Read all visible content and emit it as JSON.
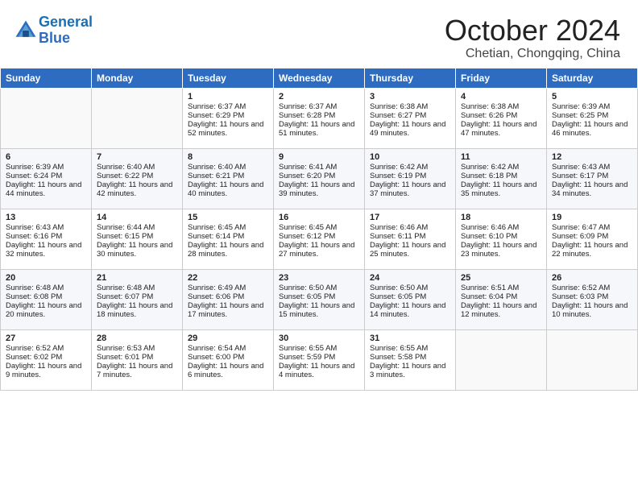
{
  "header": {
    "logo_line1": "General",
    "logo_line2": "Blue",
    "month": "October 2024",
    "location": "Chetian, Chongqing, China"
  },
  "days_of_week": [
    "Sunday",
    "Monday",
    "Tuesday",
    "Wednesday",
    "Thursday",
    "Friday",
    "Saturday"
  ],
  "weeks": [
    [
      {
        "day": "",
        "sunrise": "",
        "sunset": "",
        "daylight": ""
      },
      {
        "day": "",
        "sunrise": "",
        "sunset": "",
        "daylight": ""
      },
      {
        "day": "1",
        "sunrise": "Sunrise: 6:37 AM",
        "sunset": "Sunset: 6:29 PM",
        "daylight": "Daylight: 11 hours and 52 minutes."
      },
      {
        "day": "2",
        "sunrise": "Sunrise: 6:37 AM",
        "sunset": "Sunset: 6:28 PM",
        "daylight": "Daylight: 11 hours and 51 minutes."
      },
      {
        "day": "3",
        "sunrise": "Sunrise: 6:38 AM",
        "sunset": "Sunset: 6:27 PM",
        "daylight": "Daylight: 11 hours and 49 minutes."
      },
      {
        "day": "4",
        "sunrise": "Sunrise: 6:38 AM",
        "sunset": "Sunset: 6:26 PM",
        "daylight": "Daylight: 11 hours and 47 minutes."
      },
      {
        "day": "5",
        "sunrise": "Sunrise: 6:39 AM",
        "sunset": "Sunset: 6:25 PM",
        "daylight": "Daylight: 11 hours and 46 minutes."
      }
    ],
    [
      {
        "day": "6",
        "sunrise": "Sunrise: 6:39 AM",
        "sunset": "Sunset: 6:24 PM",
        "daylight": "Daylight: 11 hours and 44 minutes."
      },
      {
        "day": "7",
        "sunrise": "Sunrise: 6:40 AM",
        "sunset": "Sunset: 6:22 PM",
        "daylight": "Daylight: 11 hours and 42 minutes."
      },
      {
        "day": "8",
        "sunrise": "Sunrise: 6:40 AM",
        "sunset": "Sunset: 6:21 PM",
        "daylight": "Daylight: 11 hours and 40 minutes."
      },
      {
        "day": "9",
        "sunrise": "Sunrise: 6:41 AM",
        "sunset": "Sunset: 6:20 PM",
        "daylight": "Daylight: 11 hours and 39 minutes."
      },
      {
        "day": "10",
        "sunrise": "Sunrise: 6:42 AM",
        "sunset": "Sunset: 6:19 PM",
        "daylight": "Daylight: 11 hours and 37 minutes."
      },
      {
        "day": "11",
        "sunrise": "Sunrise: 6:42 AM",
        "sunset": "Sunset: 6:18 PM",
        "daylight": "Daylight: 11 hours and 35 minutes."
      },
      {
        "day": "12",
        "sunrise": "Sunrise: 6:43 AM",
        "sunset": "Sunset: 6:17 PM",
        "daylight": "Daylight: 11 hours and 34 minutes."
      }
    ],
    [
      {
        "day": "13",
        "sunrise": "Sunrise: 6:43 AM",
        "sunset": "Sunset: 6:16 PM",
        "daylight": "Daylight: 11 hours and 32 minutes."
      },
      {
        "day": "14",
        "sunrise": "Sunrise: 6:44 AM",
        "sunset": "Sunset: 6:15 PM",
        "daylight": "Daylight: 11 hours and 30 minutes."
      },
      {
        "day": "15",
        "sunrise": "Sunrise: 6:45 AM",
        "sunset": "Sunset: 6:14 PM",
        "daylight": "Daylight: 11 hours and 28 minutes."
      },
      {
        "day": "16",
        "sunrise": "Sunrise: 6:45 AM",
        "sunset": "Sunset: 6:12 PM",
        "daylight": "Daylight: 11 hours and 27 minutes."
      },
      {
        "day": "17",
        "sunrise": "Sunrise: 6:46 AM",
        "sunset": "Sunset: 6:11 PM",
        "daylight": "Daylight: 11 hours and 25 minutes."
      },
      {
        "day": "18",
        "sunrise": "Sunrise: 6:46 AM",
        "sunset": "Sunset: 6:10 PM",
        "daylight": "Daylight: 11 hours and 23 minutes."
      },
      {
        "day": "19",
        "sunrise": "Sunrise: 6:47 AM",
        "sunset": "Sunset: 6:09 PM",
        "daylight": "Daylight: 11 hours and 22 minutes."
      }
    ],
    [
      {
        "day": "20",
        "sunrise": "Sunrise: 6:48 AM",
        "sunset": "Sunset: 6:08 PM",
        "daylight": "Daylight: 11 hours and 20 minutes."
      },
      {
        "day": "21",
        "sunrise": "Sunrise: 6:48 AM",
        "sunset": "Sunset: 6:07 PM",
        "daylight": "Daylight: 11 hours and 18 minutes."
      },
      {
        "day": "22",
        "sunrise": "Sunrise: 6:49 AM",
        "sunset": "Sunset: 6:06 PM",
        "daylight": "Daylight: 11 hours and 17 minutes."
      },
      {
        "day": "23",
        "sunrise": "Sunrise: 6:50 AM",
        "sunset": "Sunset: 6:05 PM",
        "daylight": "Daylight: 11 hours and 15 minutes."
      },
      {
        "day": "24",
        "sunrise": "Sunrise: 6:50 AM",
        "sunset": "Sunset: 6:05 PM",
        "daylight": "Daylight: 11 hours and 14 minutes."
      },
      {
        "day": "25",
        "sunrise": "Sunrise: 6:51 AM",
        "sunset": "Sunset: 6:04 PM",
        "daylight": "Daylight: 11 hours and 12 minutes."
      },
      {
        "day": "26",
        "sunrise": "Sunrise: 6:52 AM",
        "sunset": "Sunset: 6:03 PM",
        "daylight": "Daylight: 11 hours and 10 minutes."
      }
    ],
    [
      {
        "day": "27",
        "sunrise": "Sunrise: 6:52 AM",
        "sunset": "Sunset: 6:02 PM",
        "daylight": "Daylight: 11 hours and 9 minutes."
      },
      {
        "day": "28",
        "sunrise": "Sunrise: 6:53 AM",
        "sunset": "Sunset: 6:01 PM",
        "daylight": "Daylight: 11 hours and 7 minutes."
      },
      {
        "day": "29",
        "sunrise": "Sunrise: 6:54 AM",
        "sunset": "Sunset: 6:00 PM",
        "daylight": "Daylight: 11 hours and 6 minutes."
      },
      {
        "day": "30",
        "sunrise": "Sunrise: 6:55 AM",
        "sunset": "Sunset: 5:59 PM",
        "daylight": "Daylight: 11 hours and 4 minutes."
      },
      {
        "day": "31",
        "sunrise": "Sunrise: 6:55 AM",
        "sunset": "Sunset: 5:58 PM",
        "daylight": "Daylight: 11 hours and 3 minutes."
      },
      {
        "day": "",
        "sunrise": "",
        "sunset": "",
        "daylight": ""
      },
      {
        "day": "",
        "sunrise": "",
        "sunset": "",
        "daylight": ""
      }
    ]
  ]
}
